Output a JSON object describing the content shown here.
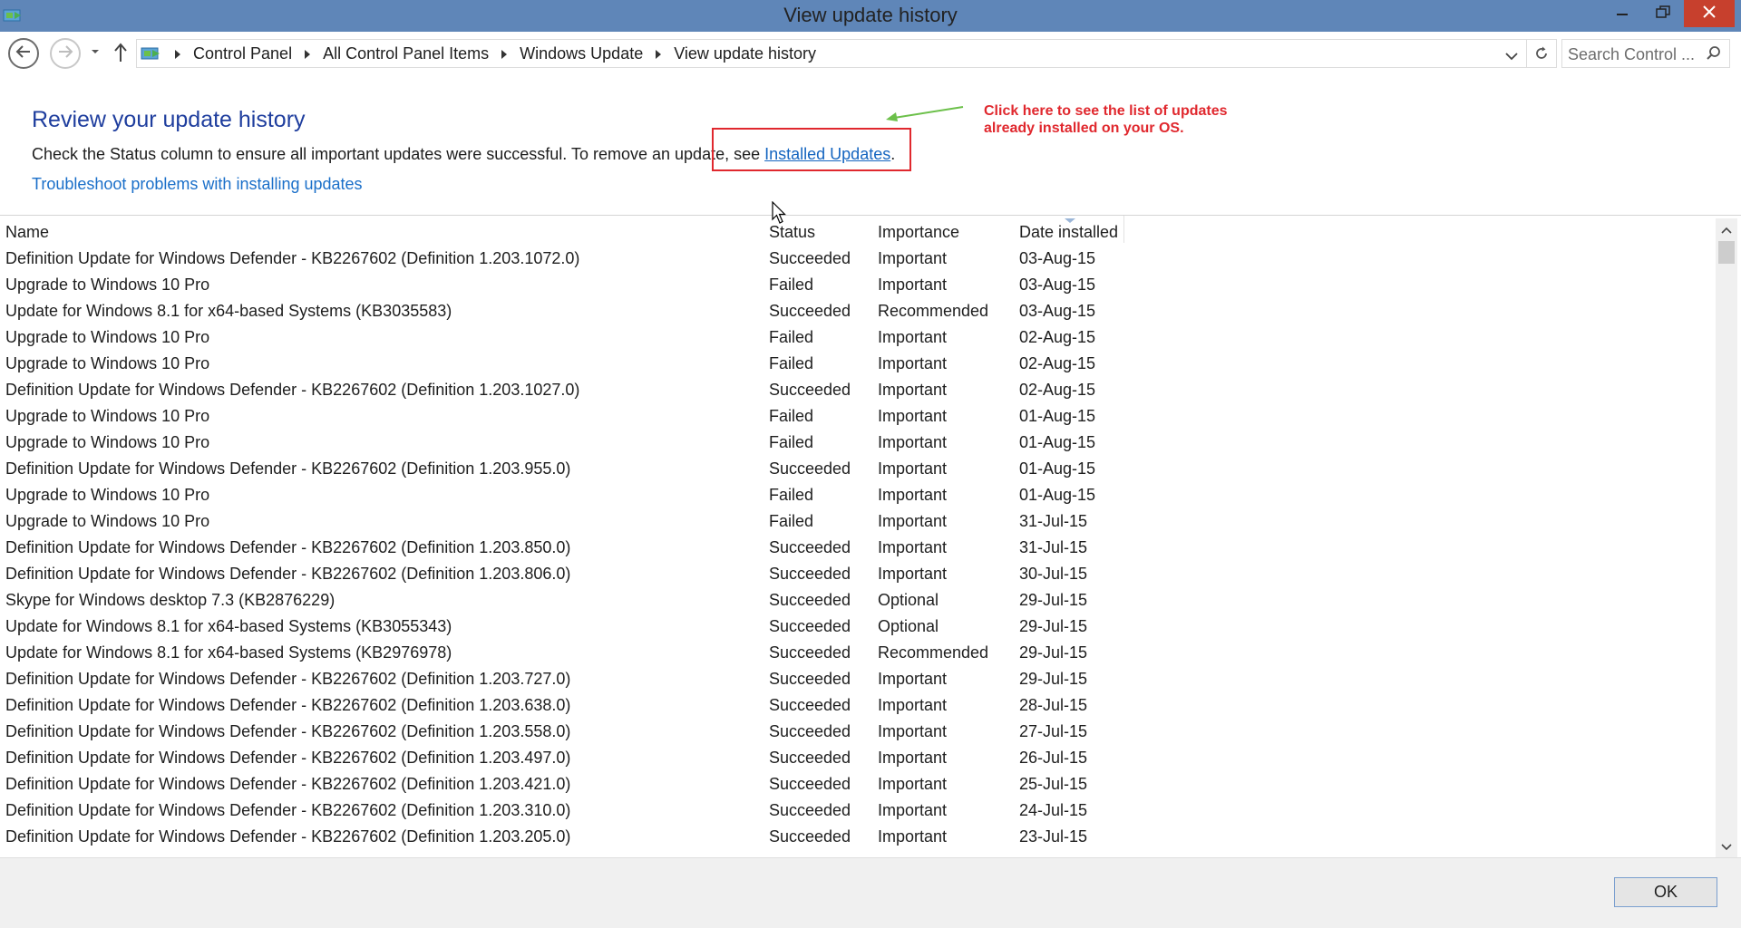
{
  "window": {
    "title": "View update history",
    "icons": {
      "app": "control-panel-icon",
      "minimize": "minimize-icon",
      "maximize": "restore-icon",
      "close": "close-icon"
    },
    "colors": {
      "titlebar": "#5f86b8",
      "close": "#c7402d"
    }
  },
  "nav": {
    "breadcrumbs": [
      "Control Panel",
      "All Control Panel Items",
      "Windows Update",
      "View update history"
    ],
    "search_placeholder": "Search Control ..."
  },
  "header": {
    "title": "Review your update history",
    "description_prefix": "Check the Status column to ensure all important updates were successful. To remove an update, see ",
    "installed_updates_link": "Installed Updates",
    "description_suffix": ".",
    "troubleshoot_link": "Troubleshoot problems with installing updates"
  },
  "annotation": {
    "text": "Click here to see the list of updates already installed on your OS.",
    "color": "#e0282e"
  },
  "table": {
    "columns": {
      "name": "Name",
      "status": "Status",
      "importance": "Importance",
      "date": "Date installed"
    },
    "rows": [
      {
        "name": "Definition Update for Windows Defender - KB2267602 (Definition 1.203.1072.0)",
        "status": "Succeeded",
        "importance": "Important",
        "date": "03-Aug-15"
      },
      {
        "name": "Upgrade to Windows 10 Pro",
        "status": "Failed",
        "importance": "Important",
        "date": "03-Aug-15"
      },
      {
        "name": "Update for Windows 8.1 for x64-based Systems (KB3035583)",
        "status": "Succeeded",
        "importance": "Recommended",
        "date": "03-Aug-15"
      },
      {
        "name": "Upgrade to Windows 10 Pro",
        "status": "Failed",
        "importance": "Important",
        "date": "02-Aug-15"
      },
      {
        "name": "Upgrade to Windows 10 Pro",
        "status": "Failed",
        "importance": "Important",
        "date": "02-Aug-15"
      },
      {
        "name": "Definition Update for Windows Defender - KB2267602 (Definition 1.203.1027.0)",
        "status": "Succeeded",
        "importance": "Important",
        "date": "02-Aug-15"
      },
      {
        "name": "Upgrade to Windows 10 Pro",
        "status": "Failed",
        "importance": "Important",
        "date": "01-Aug-15"
      },
      {
        "name": "Upgrade to Windows 10 Pro",
        "status": "Failed",
        "importance": "Important",
        "date": "01-Aug-15"
      },
      {
        "name": "Definition Update for Windows Defender - KB2267602 (Definition 1.203.955.0)",
        "status": "Succeeded",
        "importance": "Important",
        "date": "01-Aug-15"
      },
      {
        "name": "Upgrade to Windows 10 Pro",
        "status": "Failed",
        "importance": "Important",
        "date": "01-Aug-15"
      },
      {
        "name": "Upgrade to Windows 10 Pro",
        "status": "Failed",
        "importance": "Important",
        "date": "31-Jul-15"
      },
      {
        "name": "Definition Update for Windows Defender - KB2267602 (Definition 1.203.850.0)",
        "status": "Succeeded",
        "importance": "Important",
        "date": "31-Jul-15"
      },
      {
        "name": "Definition Update for Windows Defender - KB2267602 (Definition 1.203.806.0)",
        "status": "Succeeded",
        "importance": "Important",
        "date": "30-Jul-15"
      },
      {
        "name": "Skype for Windows desktop 7.3 (KB2876229)",
        "status": "Succeeded",
        "importance": "Optional",
        "date": "29-Jul-15"
      },
      {
        "name": "Update for Windows 8.1 for x64-based Systems (KB3055343)",
        "status": "Succeeded",
        "importance": "Optional",
        "date": "29-Jul-15"
      },
      {
        "name": "Update for Windows 8.1 for x64-based Systems (KB2976978)",
        "status": "Succeeded",
        "importance": "Recommended",
        "date": "29-Jul-15"
      },
      {
        "name": "Definition Update for Windows Defender - KB2267602 (Definition 1.203.727.0)",
        "status": "Succeeded",
        "importance": "Important",
        "date": "29-Jul-15"
      },
      {
        "name": "Definition Update for Windows Defender - KB2267602 (Definition 1.203.638.0)",
        "status": "Succeeded",
        "importance": "Important",
        "date": "28-Jul-15"
      },
      {
        "name": "Definition Update for Windows Defender - KB2267602 (Definition 1.203.558.0)",
        "status": "Succeeded",
        "importance": "Important",
        "date": "27-Jul-15"
      },
      {
        "name": "Definition Update for Windows Defender - KB2267602 (Definition 1.203.497.0)",
        "status": "Succeeded",
        "importance": "Important",
        "date": "26-Jul-15"
      },
      {
        "name": "Definition Update for Windows Defender - KB2267602 (Definition 1.203.421.0)",
        "status": "Succeeded",
        "importance": "Important",
        "date": "25-Jul-15"
      },
      {
        "name": "Definition Update for Windows Defender - KB2267602 (Definition 1.203.310.0)",
        "status": "Succeeded",
        "importance": "Important",
        "date": "24-Jul-15"
      },
      {
        "name": "Definition Update for Windows Defender - KB2267602 (Definition 1.203.205.0)",
        "status": "Succeeded",
        "importance": "Important",
        "date": "23-Jul-15"
      }
    ]
  },
  "footer": {
    "ok_label": "OK"
  }
}
